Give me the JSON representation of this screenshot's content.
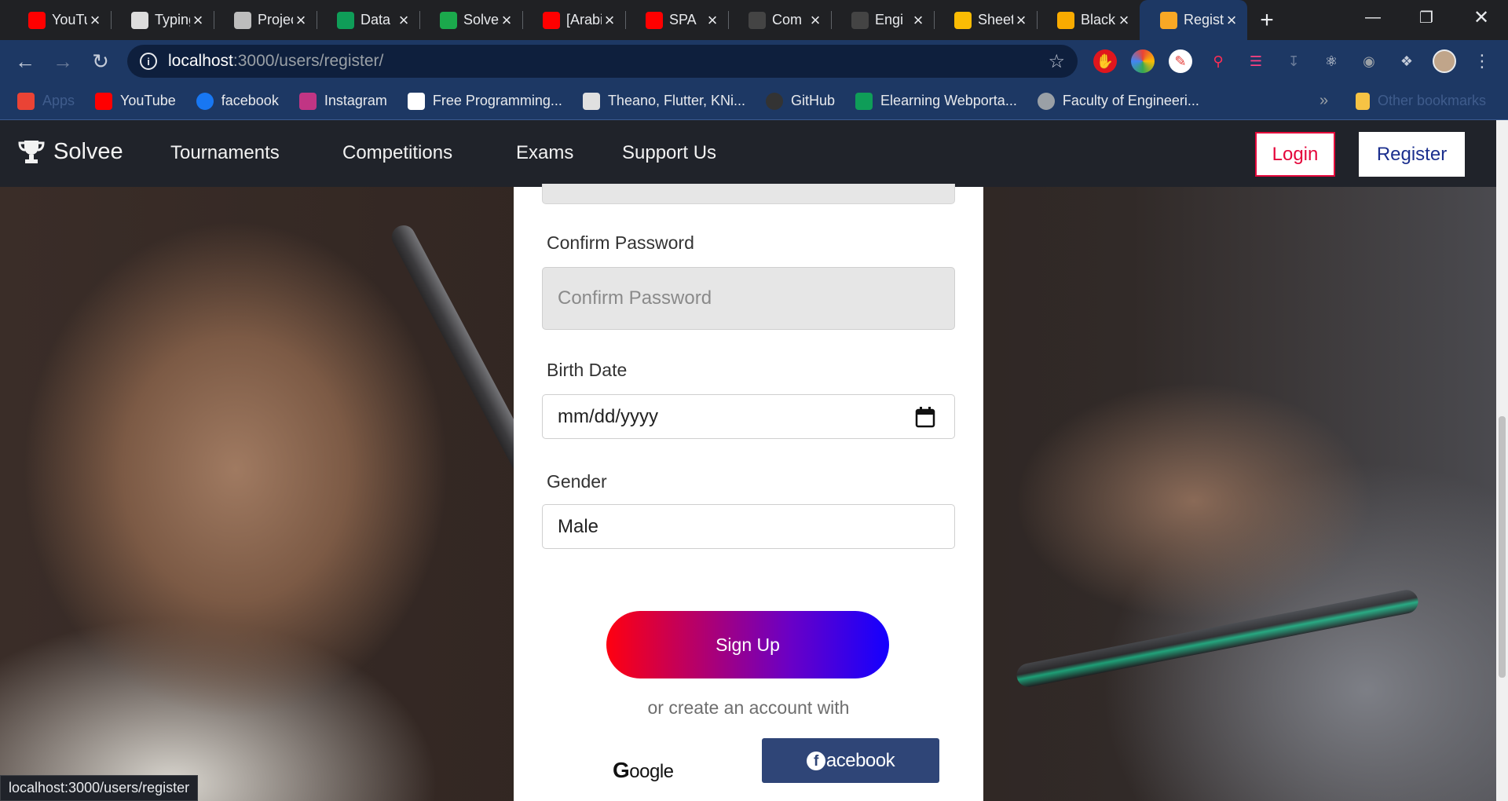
{
  "browser": {
    "tabs": [
      {
        "title": "YouTube",
        "icon": "youtube-icon",
        "color": "#ff0000"
      },
      {
        "title": "Typing",
        "icon": "document-icon",
        "color": "#dddddd"
      },
      {
        "title": "Projects",
        "icon": "contact-icon",
        "color": "#bdbdbd"
      },
      {
        "title": "Data",
        "icon": "sheets-icon",
        "color": "#0f9d58"
      },
      {
        "title": "Solve",
        "icon": "hackerrank-icon",
        "color": "#1ba94c"
      },
      {
        "title": "[Arabic",
        "icon": "youtube-icon",
        "color": "#ff0000"
      },
      {
        "title": "SPA",
        "icon": "youtube-icon",
        "color": "#ff0000"
      },
      {
        "title": "Com",
        "icon": "github-icon",
        "color": "#444444"
      },
      {
        "title": "Engi",
        "icon": "github-icon",
        "color": "#444444"
      },
      {
        "title": "Sheets",
        "icon": "drive-icon",
        "color": "#fbbc04"
      },
      {
        "title": "Black",
        "icon": "pencil-icon",
        "color": "#f9ab00"
      },
      {
        "title": "Register",
        "icon": "trophy-icon",
        "color": "#f9a825",
        "active": true
      }
    ],
    "new_tab": "+",
    "address": {
      "host": "localhost",
      "rest": ":3000/users/register/"
    },
    "bookmarks": [
      {
        "label": "Apps",
        "icon": "apps-grid-icon",
        "dim": true
      },
      {
        "label": "YouTube",
        "icon": "youtube-icon"
      },
      {
        "label": "facebook",
        "icon": "facebook-icon"
      },
      {
        "label": "Instagram",
        "icon": "instagram-icon"
      },
      {
        "label": "Free Programming...",
        "icon": "freecodecamp-icon"
      },
      {
        "label": "Theano, Flutter, KNi...",
        "icon": "diamond-icon"
      },
      {
        "label": "GitHub",
        "icon": "github-icon"
      },
      {
        "label": "Elearning Webporta...",
        "icon": "elearning-icon"
      },
      {
        "label": "Faculty of Engineeri...",
        "icon": "globe-icon"
      }
    ],
    "bookmarks_overflow": "»",
    "other_bookmarks": "Other bookmarks",
    "status_url": "localhost:3000/users/register"
  },
  "site": {
    "brand": "Solvee",
    "nav": [
      "Tournaments",
      "Competitions",
      "Exams",
      "Support Us"
    ],
    "login": "Login",
    "register": "Register"
  },
  "form": {
    "confirm_password_label": "Confirm Password",
    "confirm_password_placeholder": "Confirm Password",
    "birth_date_label": "Birth Date",
    "birth_date_value": "mm/dd/yyyy",
    "gender_label": "Gender",
    "gender_value": "Male",
    "signup": "Sign Up",
    "or_text": "or create an account with",
    "google_g": "G",
    "google_rest": "oogle",
    "facebook_f": "f",
    "facebook_rest": "acebook"
  },
  "colors": {
    "navbar": "#20232a",
    "login_accent": "#e4063b",
    "register_text": "#1b2f8e",
    "facebook_bg": "#2f4577",
    "signup_gradient_start": "#ff0010",
    "signup_gradient_end": "#1400ff"
  }
}
